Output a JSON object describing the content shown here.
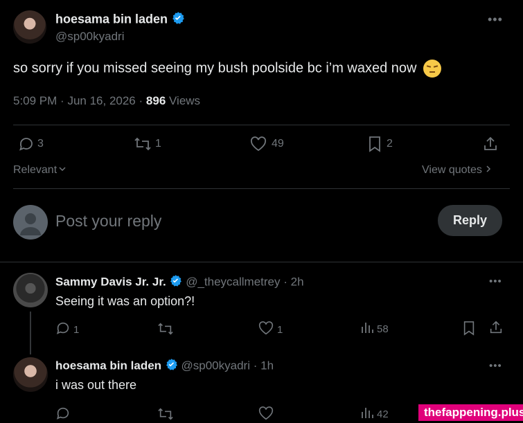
{
  "tweet": {
    "author_name": "hoesama bin laden",
    "handle": "@sp00kyadri",
    "text": "so sorry if you missed seeing my bush poolside bc i’m waxed now",
    "emoji": "😔",
    "time": "5:09 PM",
    "date": "Jun 16, 2026",
    "sep": "·",
    "views_count": "896",
    "views_label": "Views",
    "stats": {
      "replies": "3",
      "retweets": "1",
      "likes": "49",
      "bookmarks": "2"
    }
  },
  "sort": {
    "label": "Relevant",
    "view_quotes": "View quotes"
  },
  "composer": {
    "placeholder": "Post your reply",
    "button": "Reply"
  },
  "replies": [
    {
      "author_name": "Sammy Davis Jr. Jr.",
      "handle": "@_theycallmetrey",
      "time": "2h",
      "text": "Seeing it was an option?!",
      "replies": "1",
      "likes": "1",
      "views": "58"
    },
    {
      "author_name": "hoesama bin laden",
      "handle": "@sp00kyadri",
      "time": "1h",
      "text": "i was out there",
      "views": "42"
    }
  ],
  "watermark": "thefappening.plus",
  "colors": {
    "background": "#000000",
    "text": "#e7e9ea",
    "muted": "#71767b",
    "verified": "#1d9bf0",
    "divider": "#2f3336",
    "watermark": "#e0007a"
  }
}
